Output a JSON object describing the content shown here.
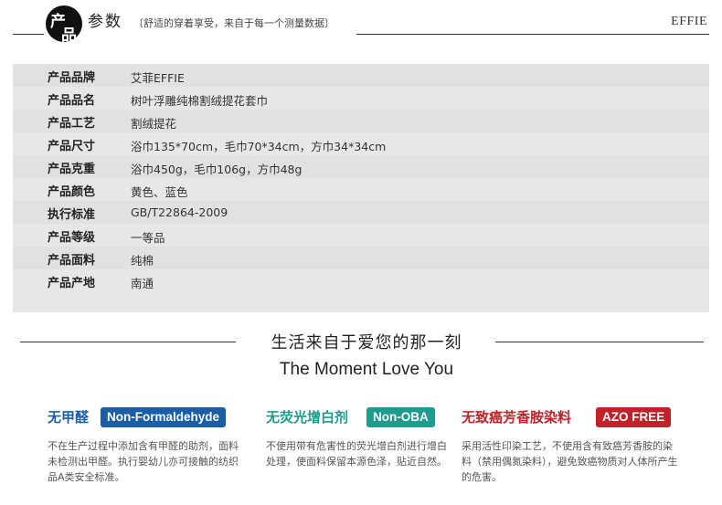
{
  "header": {
    "logo_top": "产",
    "logo_bottom": "品",
    "title": "参数",
    "subtitle": "〔舒适的穿着享受，来自于每一个测量数据〕",
    "brand": "EFFIE"
  },
  "params": [
    {
      "label": "产品品牌",
      "value": "艾菲EFFIE"
    },
    {
      "label": "产品品名",
      "value": "树叶浮雕纯棉割绒提花套巾"
    },
    {
      "label": "产品工艺",
      "value": "割绒提花"
    },
    {
      "label": "产品尺寸",
      "value": "浴巾135*70cm，毛巾70*34cm，方巾34*34cm"
    },
    {
      "label": "产品克重",
      "value": "浴巾450g，毛巾106g，方巾48g"
    },
    {
      "label": "产品颜色",
      "value": "黄色、蓝色"
    },
    {
      "label": "执行标准",
      "value": "GB/T22864-2009"
    },
    {
      "label": "产品等级",
      "value": "一等品"
    },
    {
      "label": "产品面料",
      "value": "纯棉"
    },
    {
      "label": "产品产地",
      "value": "南通"
    }
  ],
  "slogan": {
    "cn": "生活来自于爱您的那一刻",
    "en": "The Moment Love You"
  },
  "features": [
    {
      "title": "无甲醛",
      "badge": "Non-Formaldehyde",
      "color": "#1a5ea8",
      "desc": "不在生产过程中添加含有甲醛的助剂，面料未检测出甲醛。执行婴幼儿亦可接触的纺织品A类安全标准。"
    },
    {
      "title": "无荧光增白剂",
      "badge": "Non-OBA",
      "color": "#1f9a8e",
      "desc": "不使用带有危害性的荧光增白剂进行增白处理，使面料保留本源色泽，贴近自然。"
    },
    {
      "title": "无致癌芳香胺染料",
      "badge": "AZO FREE",
      "color": "#c0222a",
      "desc": "采用活性印染工艺，不使用含有致癌芳香胺的染料（禁用偶氮染料），避免致癌物质对人体所产生的危害。"
    }
  ]
}
